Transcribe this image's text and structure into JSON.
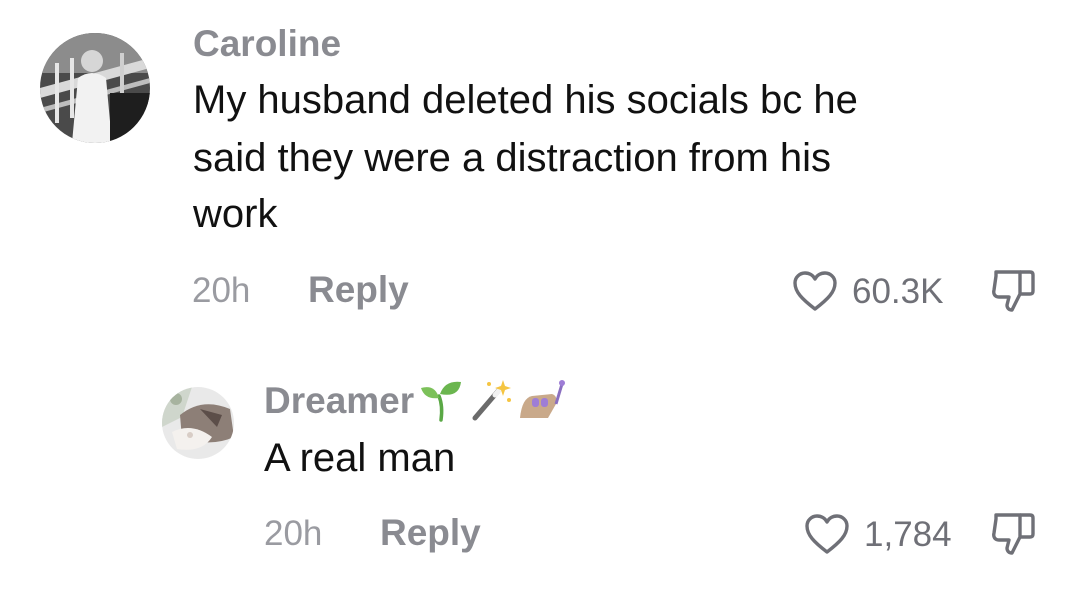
{
  "comments": [
    {
      "username": "Caroline",
      "text_lines": [
        "My husband deleted his socials bc he",
        "said they were a distraction from his",
        "work"
      ],
      "time": "20h",
      "reply_label": "Reply",
      "likes": "60.3K",
      "avatar_icon": "user-photo-avatar",
      "like_icon": "heart-outline-icon",
      "dislike_icon": "thumbs-down-icon"
    },
    {
      "username": "Dreamer",
      "username_emojis": [
        "seedling-emoji",
        "magic-wand-emoji",
        "nail-polish-emoji"
      ],
      "text": "A real man",
      "time": "20h",
      "reply_label": "Reply",
      "likes": "1,784",
      "avatar_icon": "cat-photo-avatar",
      "like_icon": "heart-outline-icon",
      "dislike_icon": "thumbs-down-icon"
    }
  ],
  "colors": {
    "username": "#8a8b91",
    "body": "#111111",
    "meta": "#9a9ba1",
    "icons": "#6f7077"
  }
}
